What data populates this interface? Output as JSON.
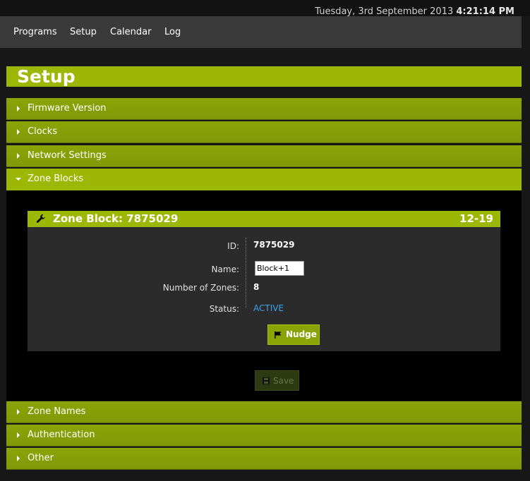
{
  "header": {
    "date": "Tuesday, 3rd September 2013",
    "time": "4:21:14 PM"
  },
  "nav": {
    "items": [
      "Programs",
      "Setup",
      "Calendar",
      "Log"
    ]
  },
  "page": {
    "title": "Setup"
  },
  "sections": [
    {
      "label": "Firmware Version",
      "expanded": false
    },
    {
      "label": "Clocks",
      "expanded": false
    },
    {
      "label": "Network Settings",
      "expanded": false
    },
    {
      "label": "Zone Blocks",
      "expanded": true
    },
    {
      "label": "Zone Names",
      "expanded": false
    },
    {
      "label": "Authentication",
      "expanded": false
    },
    {
      "label": "Other",
      "expanded": false
    }
  ],
  "zone_block": {
    "title": "Zone Block: 7875029",
    "range": "12-19",
    "fields": {
      "id_label": "ID:",
      "id_value": "7875029",
      "name_label": "Name:",
      "name_value": "Block+1",
      "zones_label": "Number of Zones:",
      "zones_value": "8",
      "status_label": "Status:",
      "status_value": "ACTIVE"
    },
    "nudge_label": "Nudge"
  },
  "save_label": "Save",
  "colors": {
    "accent": "#9db804",
    "section": "#849d06",
    "status": "#3aa5e6",
    "background": "#171717"
  }
}
